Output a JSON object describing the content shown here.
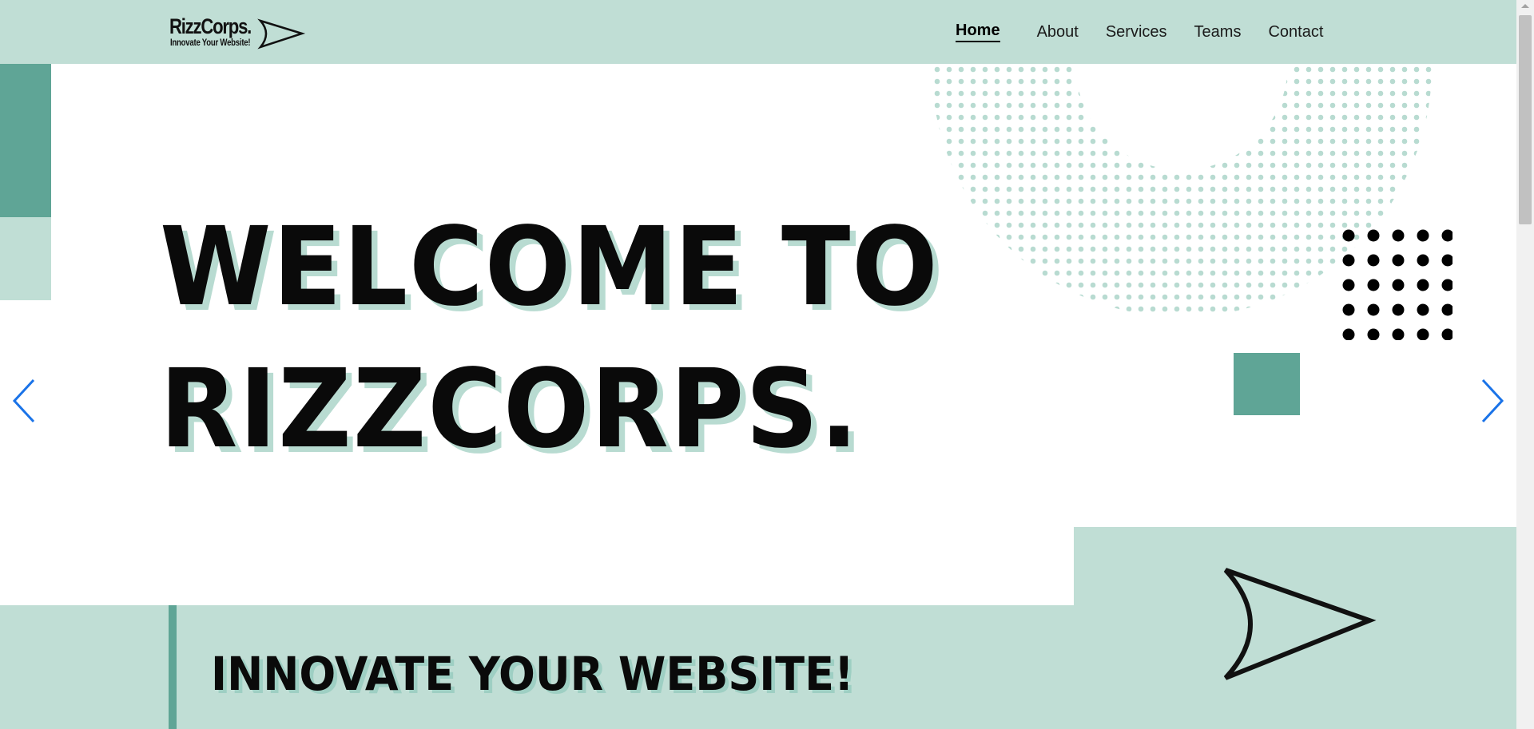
{
  "header": {
    "logo": {
      "name": "RizzCorps.",
      "tagline": "Innovate Your Website!"
    },
    "nav": [
      {
        "label": "Home",
        "active": true
      },
      {
        "label": "About",
        "active": false
      },
      {
        "label": "Services",
        "active": false
      },
      {
        "label": "Teams",
        "active": false
      },
      {
        "label": "Contact",
        "active": false
      }
    ]
  },
  "hero": {
    "title_line1": "WELCOME TO",
    "title_line2": "RIZZCORPS.",
    "carousel": {
      "prev_icon": "chevron-left-icon",
      "next_icon": "chevron-right-icon"
    }
  },
  "section": {
    "tagline": "INNOVATE YOUR WEBSITE!",
    "icon": "paper-plane-arrow-icon"
  },
  "colors": {
    "mint": "#c0ded5",
    "teal": "#5fa596",
    "text": "#0a0a0a",
    "chevron": "#1a73e8",
    "background": "#ffffff"
  }
}
